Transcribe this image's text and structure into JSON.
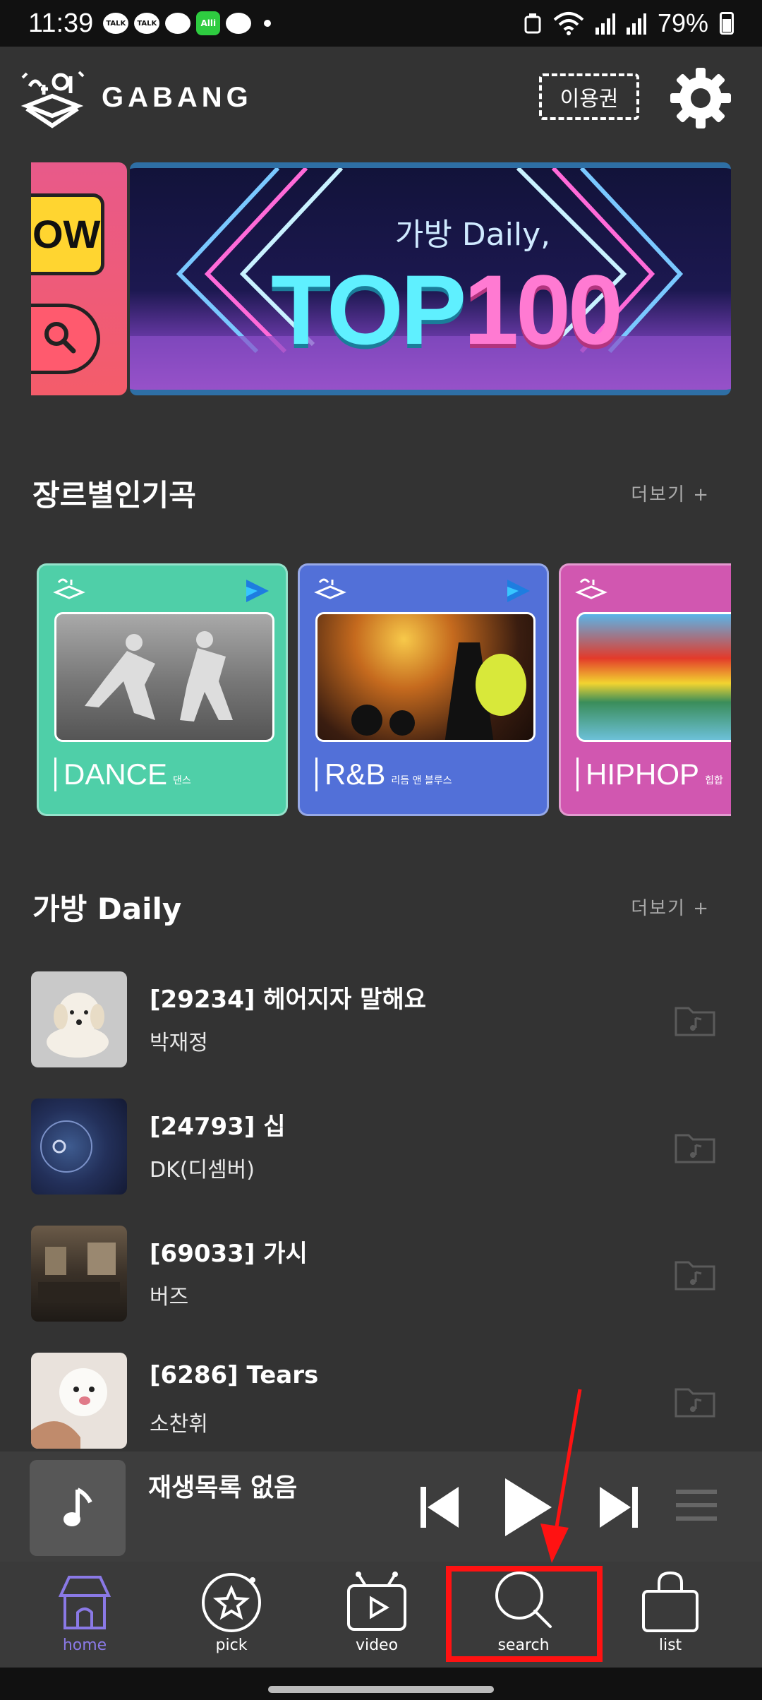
{
  "status_bar": {
    "time": "11:39",
    "notifications": [
      "TALK",
      "TALK",
      "chat",
      "Alli",
      "cloud"
    ],
    "battery": "79%"
  },
  "header": {
    "brand": "GABANG",
    "ticket_label": "이용권"
  },
  "banner": {
    "prev_text": "OW",
    "subtitle": "가방 Daily,",
    "title_part1": "TOP",
    "title_part2": "100"
  },
  "genre_section": {
    "title": "장르별인기곡",
    "more": "더보기 +",
    "cards": [
      {
        "name": "DANCE",
        "sub": "댄스",
        "color": "#4fcfa8"
      },
      {
        "name": "R&B",
        "sub": "리듬 앤 블루스",
        "color": "#5270d8"
      },
      {
        "name": "HIPHOP",
        "sub": "힙합",
        "color": "#d157b0"
      }
    ]
  },
  "daily_section": {
    "title": "가방 Daily",
    "more": "더보기 +",
    "songs": [
      {
        "title": "[29234] 헤어지자 말해요",
        "artist": "박재정"
      },
      {
        "title": "[24793] 십",
        "artist": "DK(디셈버)"
      },
      {
        "title": "[69033] 가시",
        "artist": "버즈"
      },
      {
        "title": "[6286] Tears",
        "artist": "소찬휘"
      }
    ]
  },
  "player": {
    "title": "재생목록 없음"
  },
  "bottom_nav": {
    "items": [
      {
        "label": "home",
        "icon": "home-icon",
        "active": true
      },
      {
        "label": "pick",
        "icon": "star-icon",
        "active": false
      },
      {
        "label": "video",
        "icon": "tv-play-icon",
        "active": false
      },
      {
        "label": "search",
        "icon": "search-icon",
        "active": false
      },
      {
        "label": "list",
        "icon": "bag-icon",
        "active": false
      }
    ]
  },
  "colors": {
    "background": "#333333",
    "accent": "#8a79e6",
    "annotation": "#ff1212"
  }
}
